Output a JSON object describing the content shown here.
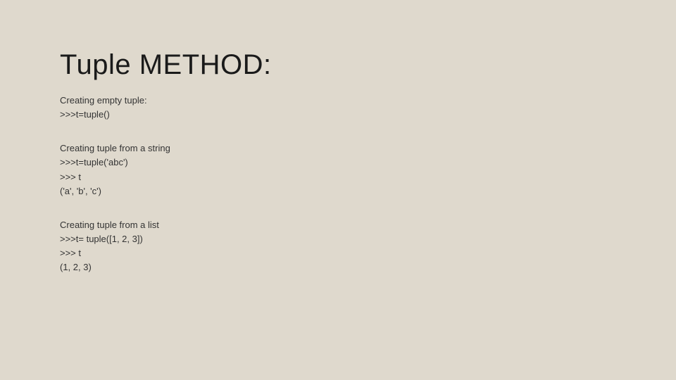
{
  "title": "Tuple METHOD:",
  "blocks": [
    {
      "lines": [
        "Creating empty tuple:",
        ">>>t=tuple()"
      ]
    },
    {
      "lines": [
        "Creating tuple from a string",
        ">>>t=tuple('abc')",
        ">>> t",
        "('a', 'b', 'c')"
      ]
    },
    {
      "lines": [
        "Creating tuple from a list",
        ">>>t= tuple([1, 2, 3])",
        ">>> t",
        "(1, 2, 3)"
      ]
    }
  ]
}
